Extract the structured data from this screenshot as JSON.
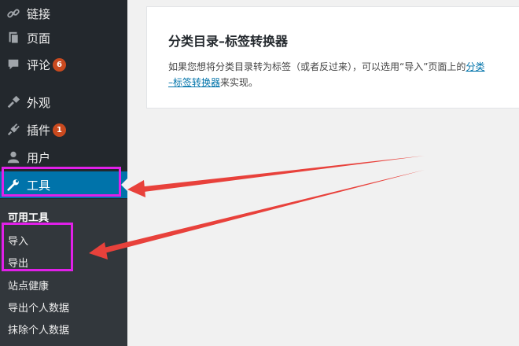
{
  "sidebar": {
    "items": [
      {
        "label": "链接",
        "icon": "link-icon"
      },
      {
        "label": "页面",
        "icon": "pages-icon"
      },
      {
        "label": "评论",
        "icon": "comments-icon",
        "badge": "6"
      },
      {
        "label": "外观",
        "icon": "appearance-icon"
      },
      {
        "label": "插件",
        "icon": "plugins-icon",
        "badge": "1"
      },
      {
        "label": "用户",
        "icon": "users-icon"
      },
      {
        "label": "工具",
        "icon": "tools-icon",
        "active": true
      }
    ],
    "submenu": {
      "heading": "可用工具",
      "items": [
        "导入",
        "导出",
        "站点健康",
        "导出个人数据",
        "抹除个人数据"
      ]
    }
  },
  "card": {
    "title": "分类目录–标签转换器",
    "desc_line1_prefix": "如果您想将分类目录转为标签（或者反过来），可以选用“导入”页面上的",
    "desc_line1_link": "分类",
    "desc_line2_link": "–标签转换器",
    "desc_line2_suffix": "来实现。"
  },
  "colors": {
    "sidebar_bg": "#23282d",
    "submenu_bg": "#32373c",
    "active_bg": "#0073aa",
    "badge_bg": "#ca4a1f",
    "highlight": "#e020e8",
    "arrow": "#e8413b",
    "link": "#0073aa"
  }
}
